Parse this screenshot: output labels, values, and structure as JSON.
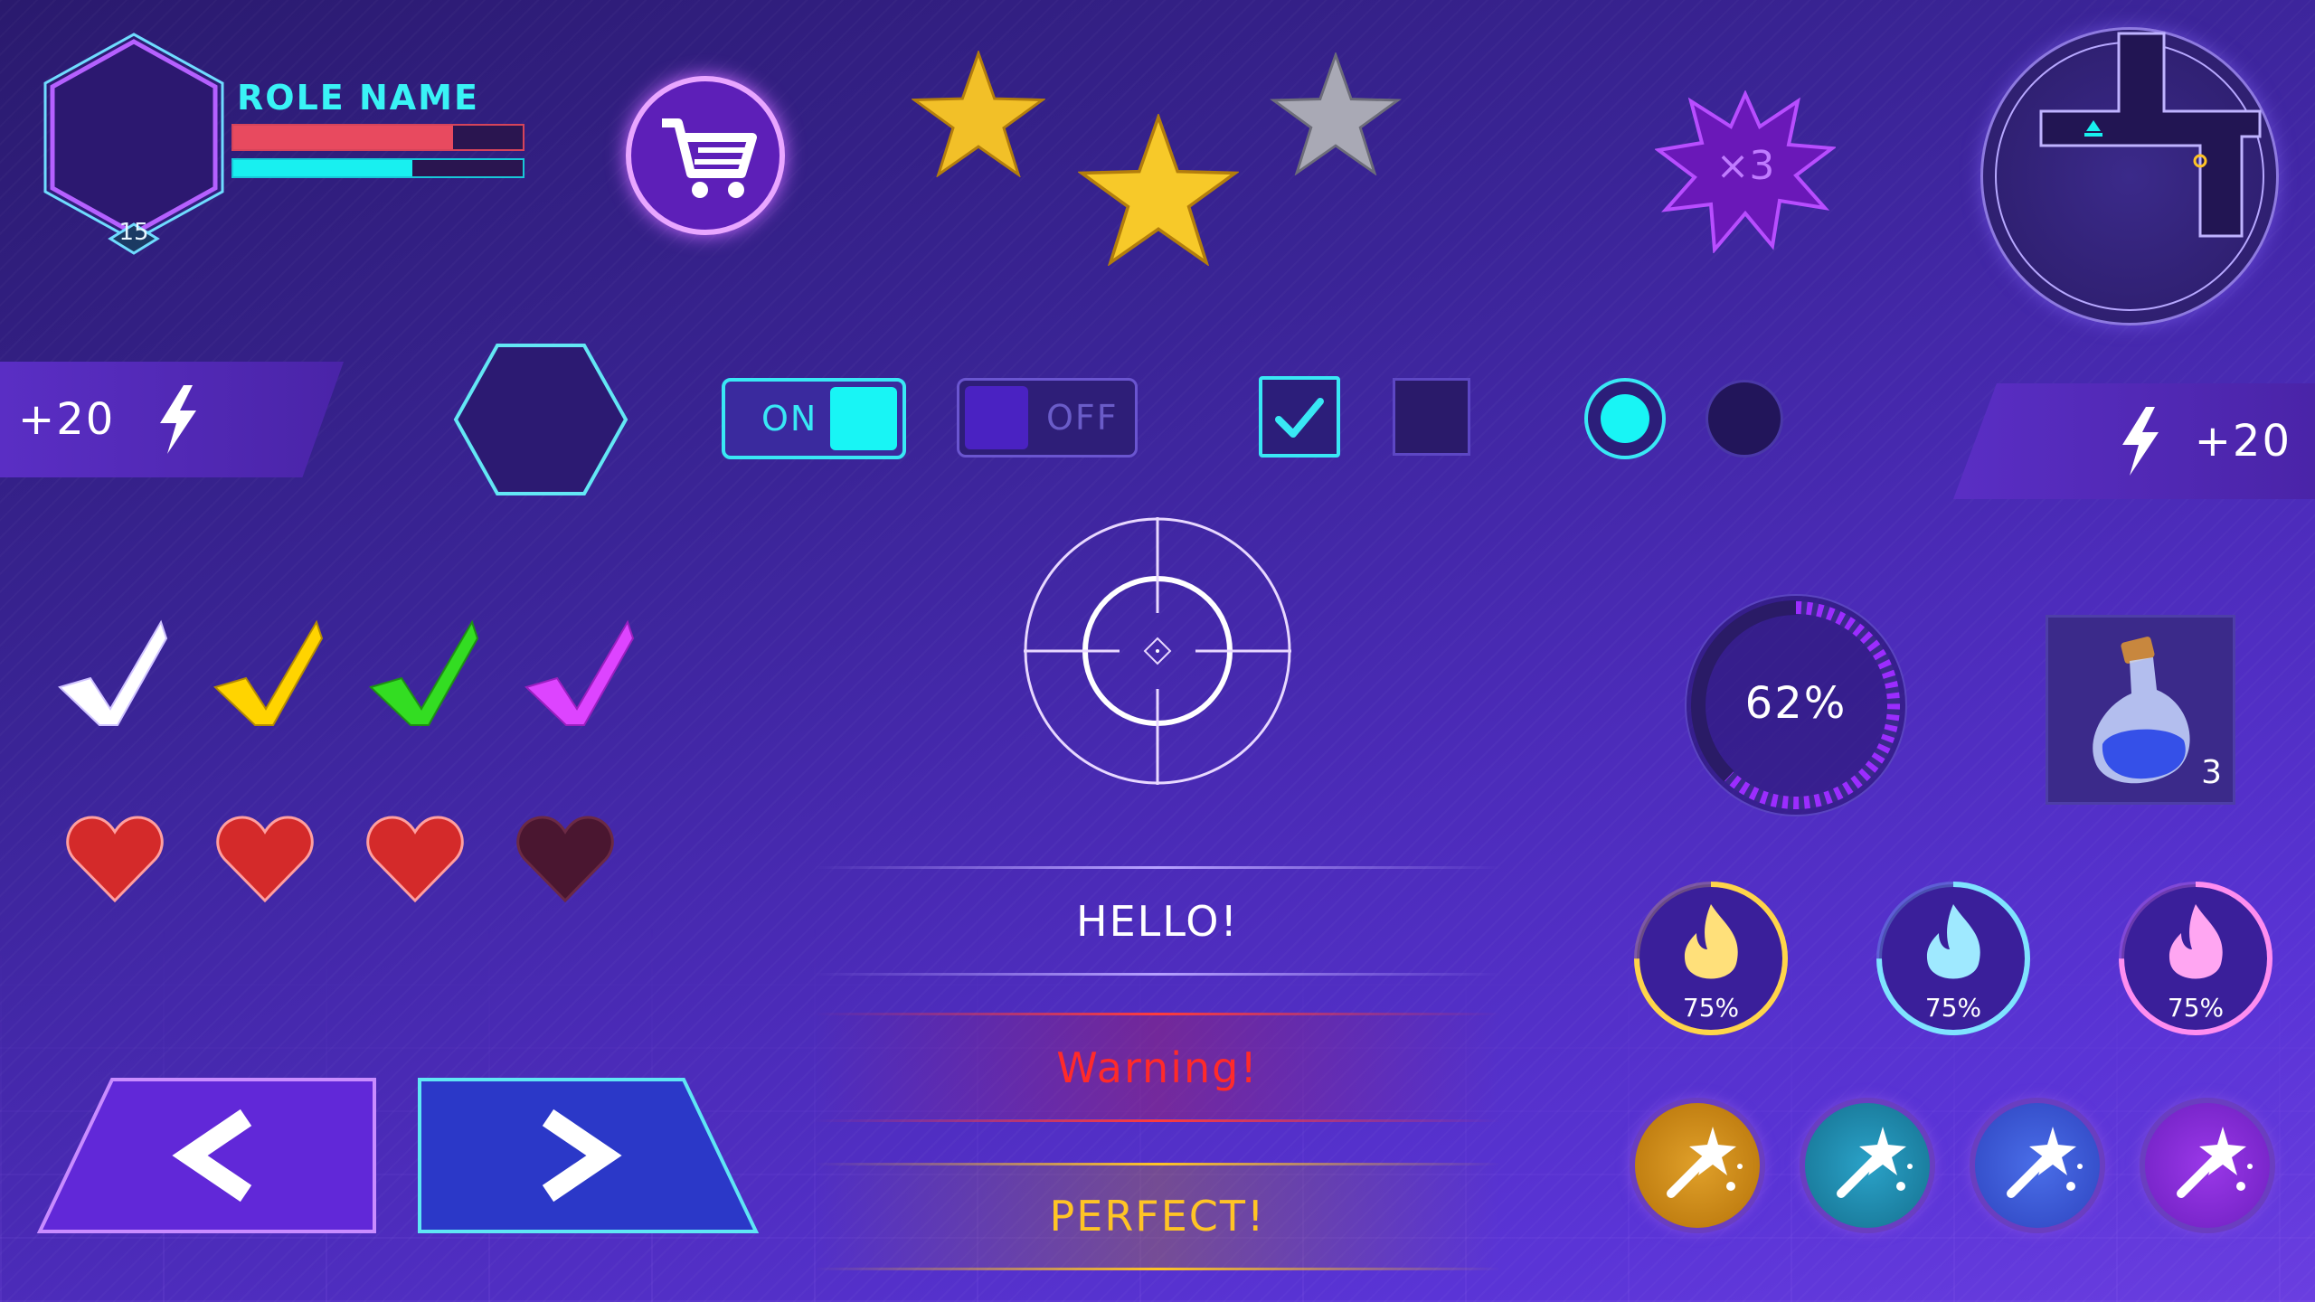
{
  "player": {
    "role_name": "ROLE NAME",
    "level": "15",
    "health_pct": 0.76,
    "mana_pct": 0.62
  },
  "stars": [
    {
      "type": "gold"
    },
    {
      "type": "gold"
    },
    {
      "type": "silver"
    }
  ],
  "multiplier": {
    "text": "×3"
  },
  "energy_left": {
    "text": "+20"
  },
  "energy_right": {
    "text": "+20"
  },
  "toggles": {
    "on_label": "ON",
    "off_label": "OFF"
  },
  "progress": {
    "text": "62%",
    "value": 0.62
  },
  "potion": {
    "count": "3"
  },
  "skills": [
    {
      "label": "75%",
      "color": "#ffd54a",
      "value": 0.75
    },
    {
      "label": "75%",
      "color": "#7fe3ff",
      "value": 0.75
    },
    {
      "label": "75%",
      "color": "#ff8df0",
      "value": 0.75
    }
  ],
  "messages": {
    "hello": "HELLO!",
    "warning": "Warning!",
    "perfect": "PERFECT!"
  },
  "checkmarks": [
    "#ffffff",
    "#ffd400",
    "#33dd22",
    "#dd44ff"
  ],
  "hearts": [
    "full",
    "full",
    "full",
    "empty"
  ],
  "colors": {
    "cyan": "#18f0f0",
    "health": "#e84a5f",
    "accent": "#b84dff"
  }
}
